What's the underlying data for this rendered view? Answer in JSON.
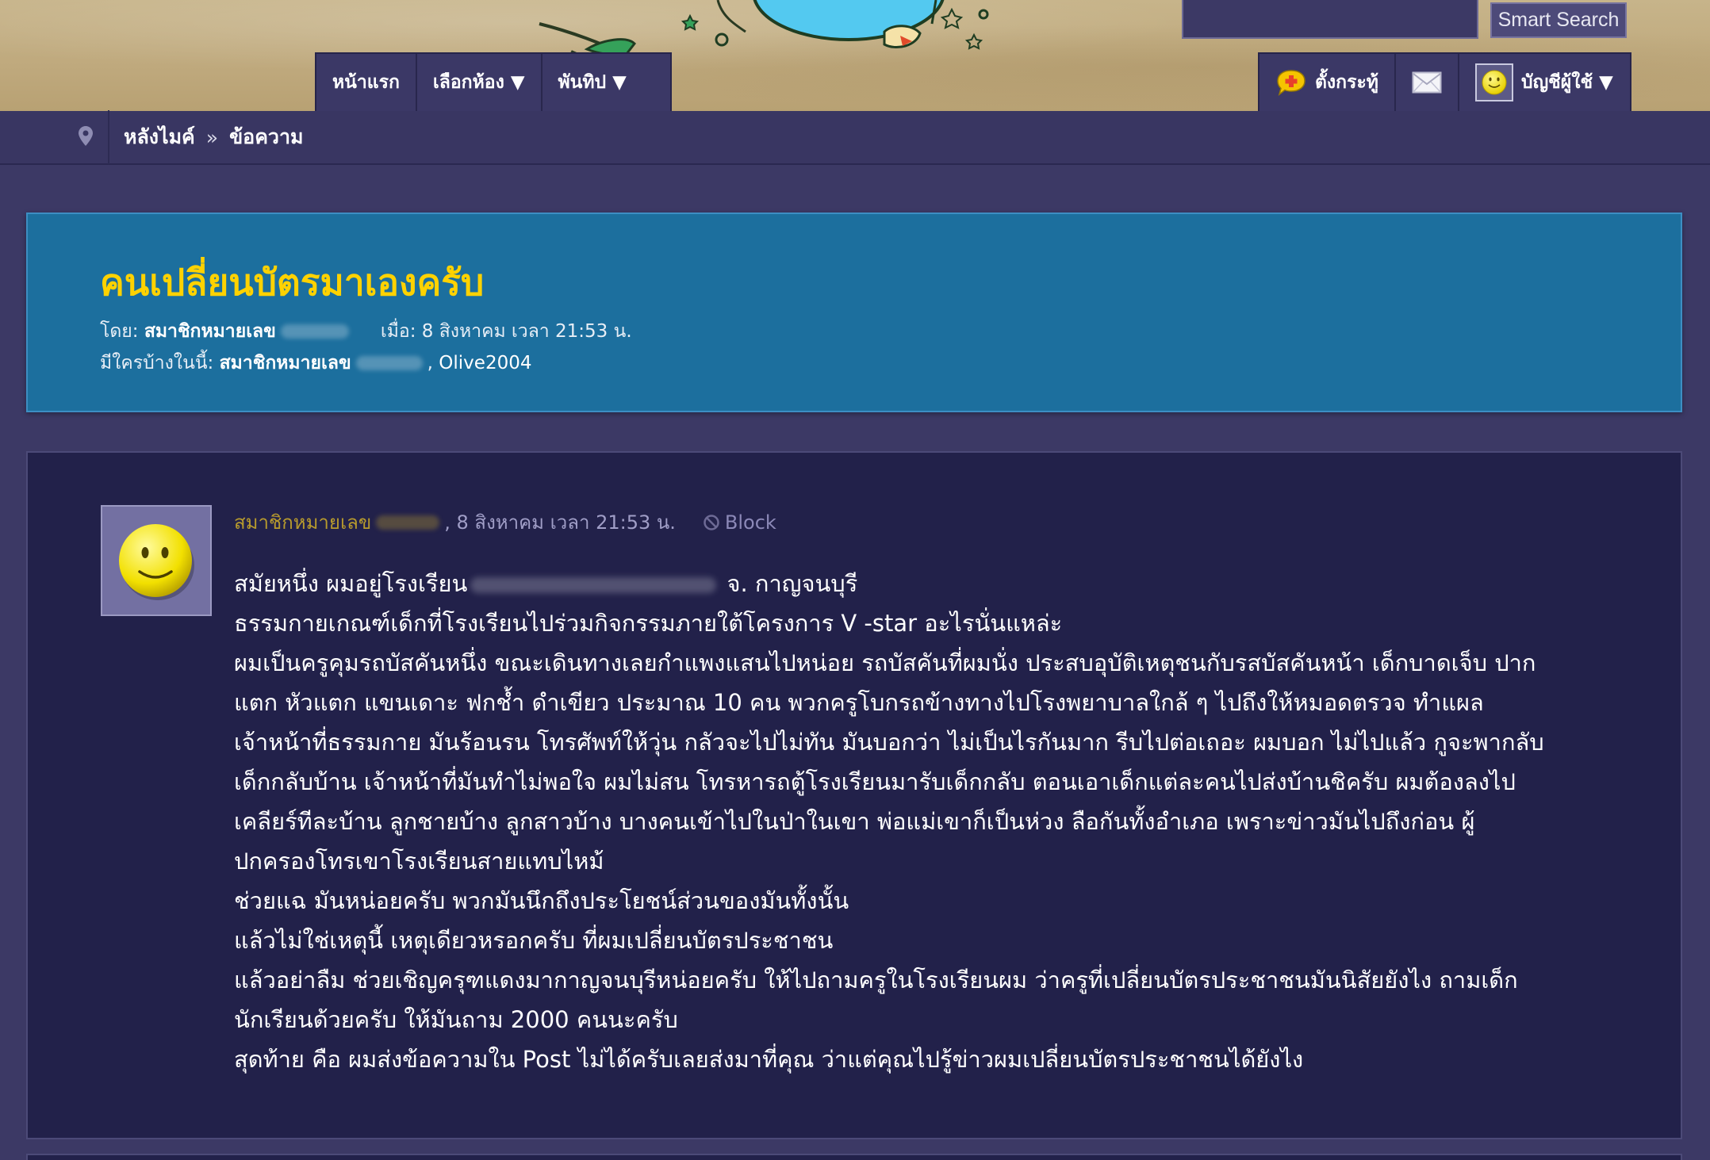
{
  "header": {
    "search": {
      "placeholder": "",
      "button_label": "Smart Search"
    },
    "nav_left": [
      {
        "label": "หน้าแรก"
      },
      {
        "label": "เลือกห้อง ▼"
      },
      {
        "label": "พันทิป ▼"
      }
    ],
    "nav_right": {
      "new_post_label": "ตั้งกระทู้",
      "account_label": "บัญชีผู้ใช้ ▼"
    }
  },
  "breadcrumb": {
    "items": [
      "หลังไมค์",
      "ข้อความ"
    ],
    "separator": "»"
  },
  "topic": {
    "title": "คนเปลี่ยนบัตรมาเองครับ",
    "by_label": "โดย:",
    "author": "สมาชิกหมายเลข",
    "date_label": "เมื่อ:",
    "date": "8 สิงหาคม เวลา 21:53 น.",
    "participants_label": "มีใครบ้างในนี้:",
    "participant_1": "สมาชิกหมายเลข",
    "participant_2": "Olive2004"
  },
  "post": {
    "author": "สมาชิกหมายเลข",
    "date": ", 8 สิงหาคม เวลา 21:53 น.",
    "block_label": "Block",
    "line1_a": "สมัยหนึ่ง ผมอยู่โรงเรียน",
    "line1_b": " จ. กาญจนบุรี",
    "lines": [
      "ธรรมกายเกณฑ์เด็กที่โรงเรียนไปร่วมกิจกรรมภายใต้โครงการ V -star อะไรนั่นแหล่ะ",
      "ผมเป็นครูคุมรถบัสคันหนึ่ง ขณะเดินทางเลยกำแพงแสนไปหน่อย รถบัสคันที่ผมนั่ง ประสบอุบัติเหตุชนกับรสบัสคันหน้า เด็กบาดเจ็บ ปาก",
      "แตก หัวแตก แขนเดาะ ฟกช้ำ ดำเขียว ประมาณ 10 คน พวกครูโบกรถข้างทางไปโรงพยาบาลใกล้ ๆ ไปถึงให้หมอดตรวจ ทำแผล",
      "เจ้าหน้าที่ธรรมกาย มันร้อนรน โทรศัพท์ให้วุ่น กลัวจะไปไม่ทัน มันบอกว่า ไม่เป็นไรกันมาก รีบไปต่อเถอะ ผมบอก ไม่ไปแล้ว กูจะพากลับ",
      "เด็กกลับบ้าน เจ้าหน้าที่มันทำไม่พอใจ ผมไม่สน โทรหารถตู้โรงเรียนมารับเด็กกลับ ตอนเอาเด็กแต่ละคนไปส่งบ้านชิครับ ผมต้องลงไป",
      "เคลียร์ทีละบ้าน ลูกชายบ้าง ลูกสาวบ้าง บางคนเข้าไปในป่าในเขา พ่อแม่เขาก็เป็นห่วง ลือกันทั้งอำเภอ เพราะข่าวมันไปถึงก่อน ผู้",
      "ปกครองโทรเขาโรงเรียนสายแทบไหม้",
      "ช่วยแฉ มันหน่อยครับ พวกมันนึกถึงประโยชน์ส่วนของมันทั้งนั้น",
      "แล้วไม่ใช่เหตุนี้ เหตุเดียวหรอกครับ ที่ผมเปลี่ยนบัตรประชาชน",
      "แล้วอย่าลืม ช่วยเชิญครุฑแดงมากาญจนบุรีหน่อยครับ ให้ไปถามครูในโรงเรียนผม ว่าครูที่เปลี่ยนบัตรประชาชนมันนิสัยยังไง ถามเด็ก",
      "นักเรียนด้วยครับ ให้มันถาม 2000 คนนะครับ",
      "สุดท้าย คือ ผมส่งข้อความใน Post ไม่ได้ครับเลยส่งมาที่คุณ ว่าแต่คุณไปรู้ข่าวผมเปลี่ยนบัตรประชาชนได้ยังไง"
    ]
  },
  "colors": {
    "page_bg": "#3c3965",
    "title_panel_bg": "#1c6f9e",
    "title_text": "#ffd200",
    "post_panel_bg": "#22214a",
    "author_link": "#b79a2d"
  },
  "icons": [
    "map-pin-icon",
    "new-post-icon",
    "mail-icon",
    "smiley-icon",
    "block-icon"
  ]
}
